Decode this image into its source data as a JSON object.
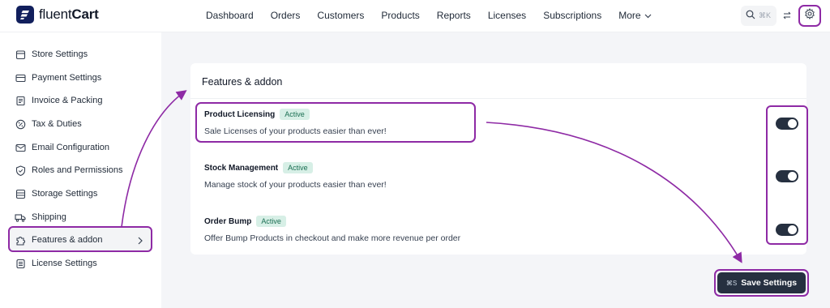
{
  "brand": {
    "name_light": "fluent",
    "name_bold": "Cart"
  },
  "nav": {
    "items": [
      {
        "label": "Dashboard"
      },
      {
        "label": "Orders"
      },
      {
        "label": "Customers"
      },
      {
        "label": "Products"
      },
      {
        "label": "Reports"
      },
      {
        "label": "Licenses"
      },
      {
        "label": "Subscriptions"
      },
      {
        "label": "More"
      }
    ],
    "search_shortcut": "⌘K"
  },
  "sidebar": {
    "items": [
      {
        "label": "Store Settings",
        "icon": "store-icon"
      },
      {
        "label": "Payment Settings",
        "icon": "credit-card-icon"
      },
      {
        "label": "Invoice & Packing",
        "icon": "invoice-icon"
      },
      {
        "label": "Tax & Duties",
        "icon": "percent-icon"
      },
      {
        "label": "Email Configuration",
        "icon": "mail-icon"
      },
      {
        "label": "Roles and Permissions",
        "icon": "shield-check-icon"
      },
      {
        "label": "Storage Settings",
        "icon": "storage-icon"
      },
      {
        "label": "Shipping",
        "icon": "truck-icon"
      },
      {
        "label": "Features & addon",
        "icon": "puzzle-icon",
        "active": true
      },
      {
        "label": "License Settings",
        "icon": "document-icon"
      }
    ]
  },
  "main": {
    "card_title": "Features & addon",
    "features": [
      {
        "name": "Product Licensing",
        "status": "Active",
        "description": "Sale Licenses of your products easier than ever!",
        "enabled": true
      },
      {
        "name": "Stock Management",
        "status": "Active",
        "description": "Manage stock of your products easier than ever!",
        "enabled": true
      },
      {
        "name": "Order Bump",
        "status": "Active",
        "description": "Offer Bump Products in checkout and make more revenue per order",
        "enabled": true
      }
    ],
    "save": {
      "shortcut": "⌘S",
      "label": "Save Settings"
    }
  },
  "colors": {
    "accent_outline": "#8e2aa5",
    "toggle_on": "#263040",
    "badge_bg": "#d7efe6",
    "badge_text": "#1b6f53",
    "logo": "#111f5c"
  }
}
